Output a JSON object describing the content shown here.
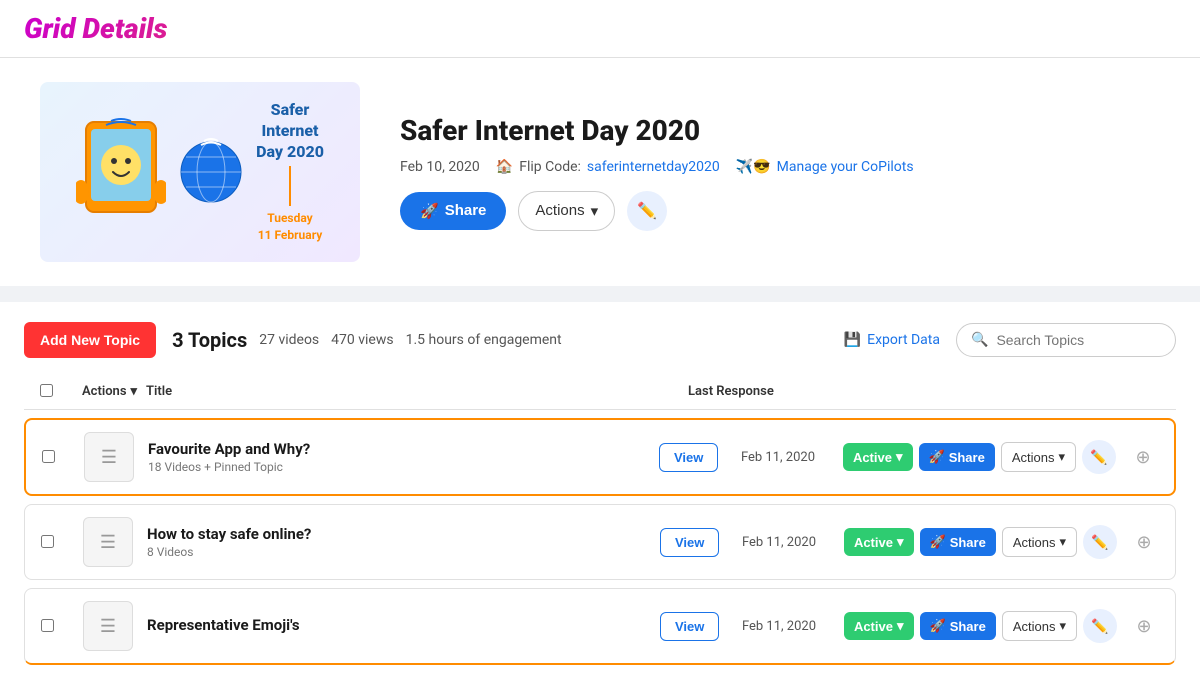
{
  "header": {
    "title": "Grid Details"
  },
  "hero": {
    "title": "Safer Internet Day 2020",
    "date": "Feb 10, 2020",
    "flip_code_label": "Flip Code:",
    "flip_code_value": "saferinternetday2020",
    "manage_copilots_label": "Manage your CoPilots",
    "share_label": "Share",
    "actions_label": "Actions",
    "edit_icon": "✏️",
    "rocket_emoji": "🚀",
    "image_emoji": "📱",
    "globe_emoji": "🌐",
    "house_emoji": "🏠",
    "sunglasses_emoji": "🕶️"
  },
  "toolbar": {
    "add_topic_label": "Add New Topic",
    "topics_count_label": "3 Topics",
    "videos_stat": "27 videos",
    "views_stat": "470 views",
    "engagement_stat": "1.5 hours of engagement",
    "export_label": "Export Data",
    "search_placeholder": "Search Topics"
  },
  "table": {
    "col_actions": "Actions",
    "col_title": "Title",
    "col_last_response": "Last Response",
    "rows": [
      {
        "title": "Favourite App and Why?",
        "subtitle": "18 Videos + Pinned Topic",
        "view_label": "View",
        "last_response": "Feb 11, 2020",
        "active_label": "Active",
        "share_label": "Share",
        "actions_label": "Actions",
        "highlighted": true
      },
      {
        "title": "How to stay safe online?",
        "subtitle": "8 Videos",
        "view_label": "View",
        "last_response": "Feb 11, 2020",
        "active_label": "Active",
        "share_label": "Share",
        "actions_label": "Actions",
        "highlighted": false
      },
      {
        "title": "Representative Emoji's",
        "subtitle": "",
        "view_label": "View",
        "last_response": "Feb 11, 2020",
        "active_label": "Active",
        "share_label": "Share",
        "actions_label": "Actions",
        "highlighted": false
      }
    ]
  }
}
